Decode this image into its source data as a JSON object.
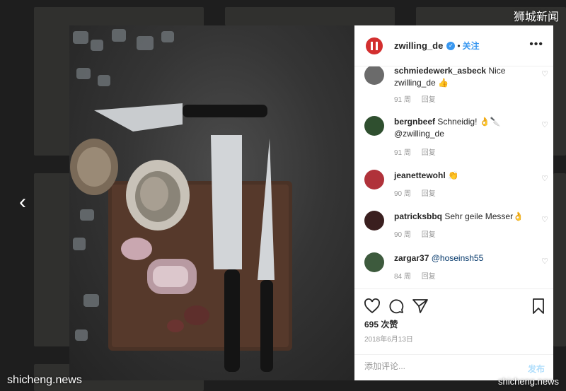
{
  "watermarks": {
    "top_right": "狮城新闻",
    "bottom_left": "shicheng.news",
    "bottom_right": "shicheng.news"
  },
  "post": {
    "username": "zwilling_de",
    "verified": true,
    "follow_label": "关注",
    "more_label": "•••",
    "likes": "695 次赞",
    "date": "2018年6月13日",
    "comment_placeholder": "添加评论...",
    "post_label": "发布"
  },
  "comments": [
    {
      "user": "schmiedewerk_asbeck",
      "text": "Nice zwilling_de 👍",
      "age": "91 周",
      "reply": "回复",
      "avatar_color": "#6b6b6b"
    },
    {
      "user": "bergnbeef",
      "text": "Schneidig! 👌🔪 @zwilling_de",
      "age": "91 周",
      "reply": "回复",
      "avatar_color": "#2f4f2f"
    },
    {
      "user": "jeanettewohl",
      "text": "👏",
      "age": "90 周",
      "reply": "回复",
      "avatar_color": "#b0323a"
    },
    {
      "user": "patricksbbq",
      "text": "Sehr geile Messer👌",
      "age": "90 周",
      "reply": "回复",
      "avatar_color": "#3a1f1f"
    },
    {
      "user": "zargar37",
      "text": "@hoseinsh55",
      "age": "84 周",
      "reply": "回复",
      "avatar_color": "#3d5a3d"
    }
  ],
  "icons": {
    "prev": "chevron-left-icon",
    "like": "heart-icon",
    "comment": "comment-icon",
    "share": "share-icon",
    "save": "bookmark-icon"
  },
  "colors": {
    "brand": "#d32f2f",
    "link": "#3897f0",
    "muted": "#999999"
  }
}
